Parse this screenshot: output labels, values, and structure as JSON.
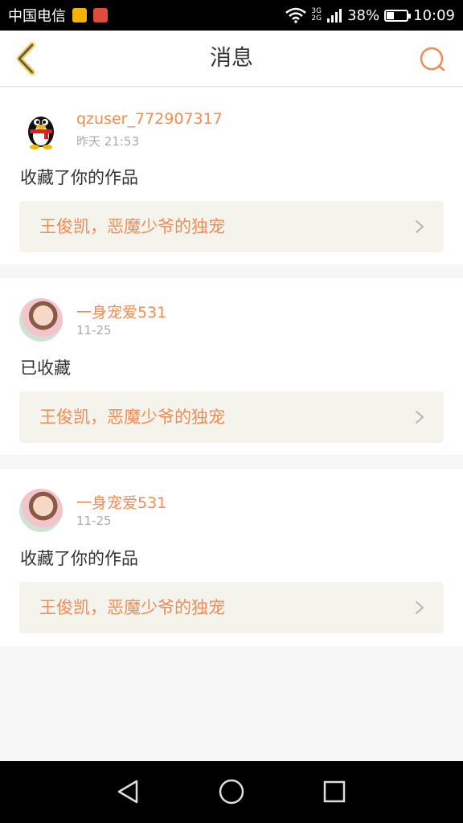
{
  "status_bar": {
    "carrier": "中国电信",
    "network_top": "3G",
    "network_bottom": "2G",
    "battery_text": "38%",
    "battery_level": 0.38,
    "time": "10:09"
  },
  "header": {
    "title": "消息",
    "back_icon": "chevron-left-icon",
    "search_icon": "search-icon",
    "accent_color": "#f08c55"
  },
  "messages": [
    {
      "username": "qzuser_772907317",
      "time": "昨天 21:53",
      "action": "收藏了你的作品",
      "work_title": "王俊凯，恶魔少爷的独宠"
    },
    {
      "username": "一身宠爱531",
      "time": "11-25",
      "action": "已收藏",
      "work_title": "王俊凯，恶魔少爷的独宠"
    },
    {
      "username": "一身宠爱531",
      "time": "11-25",
      "action": "收藏了你的作品",
      "work_title": "王俊凯，恶魔少爷的独宠"
    }
  ]
}
